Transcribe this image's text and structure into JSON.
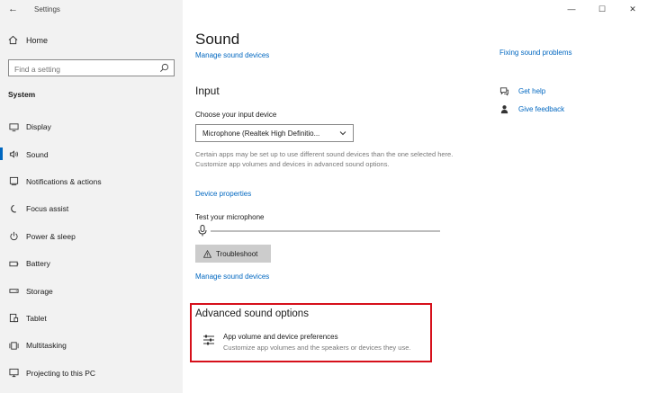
{
  "window": {
    "app_title": "Settings",
    "back_glyph": "←",
    "minimize_glyph": "—",
    "maximize_glyph": "☐",
    "close_glyph": "✕"
  },
  "sidebar": {
    "home_label": "Home",
    "search_placeholder": "Find a setting",
    "section_label": "System",
    "items": [
      {
        "label": "Display",
        "icon": "display-icon"
      },
      {
        "label": "Sound",
        "icon": "speaker-icon",
        "active": true
      },
      {
        "label": "Notifications & actions",
        "icon": "notifications-icon"
      },
      {
        "label": "Focus assist",
        "icon": "moon-icon"
      },
      {
        "label": "Power & sleep",
        "icon": "power-icon"
      },
      {
        "label": "Battery",
        "icon": "battery-icon"
      },
      {
        "label": "Storage",
        "icon": "storage-icon"
      },
      {
        "label": "Tablet",
        "icon": "tablet-icon"
      },
      {
        "label": "Multitasking",
        "icon": "multitasking-icon"
      },
      {
        "label": "Projecting to this PC",
        "icon": "projecting-icon"
      }
    ]
  },
  "main": {
    "page_title": "Sound",
    "manage_devices_top": "Manage sound devices",
    "input_heading": "Input",
    "choose_input_label": "Choose your input device",
    "input_device_value": "Microphone (Realtek High Definitio...",
    "help_text": "Certain apps may be set up to use different sound devices than the one selected here. Customize app volumes and devices in advanced sound options.",
    "device_properties_link": "Device properties",
    "test_microphone_label": "Test your microphone",
    "troubleshoot_button": "Troubleshoot",
    "manage_devices_bottom": "Manage sound devices",
    "advanced_heading": "Advanced sound options",
    "advanced_item_title": "App volume and device preferences",
    "advanced_item_desc": "Customize app volumes and the speakers or devices they use."
  },
  "right": {
    "fixing_link": "Fixing sound problems",
    "get_help": "Get help",
    "give_feedback": "Give feedback"
  },
  "colors": {
    "accent": "#0067c0",
    "highlight_box": "#d6101b",
    "sidebar_bg": "#f2f2f2"
  }
}
